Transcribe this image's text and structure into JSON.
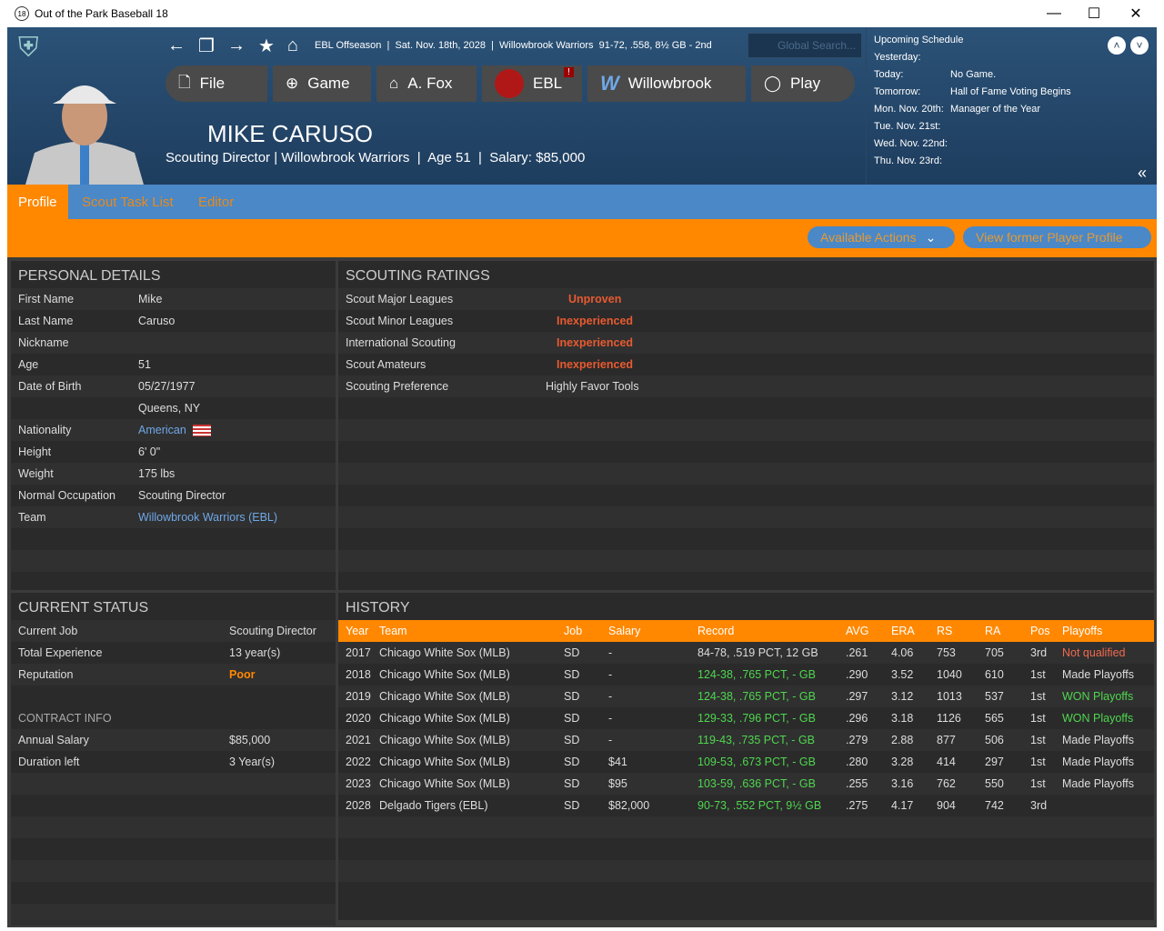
{
  "window": {
    "title": "Out of the Park Baseball 18",
    "icon_text": "18"
  },
  "nav": {
    "info": "EBL Offseason  |  Sat. Nov. 18th, 2028  |  Willowbrook Warriors  91-72, .558, 8½ GB - 2nd",
    "search_placeholder": "Global Search..."
  },
  "menu": [
    "File",
    "Game",
    "A. Fox",
    "EBL",
    "Willowbrook",
    "Play"
  ],
  "menu_badge": "!",
  "person": {
    "name": "MIKE CARUSO",
    "subtitle": "Scouting Director | Willowbrook Warriors  |  Age 51  |  Salary: $85,000"
  },
  "schedule": {
    "title": "Upcoming Schedule",
    "items": [
      {
        "day": "Yesterday:",
        "event": ""
      },
      {
        "day": "Today:",
        "event": "No Game."
      },
      {
        "day": "Tomorrow:",
        "event": "Hall of Fame Voting Begins"
      },
      {
        "day": "Mon. Nov. 20th:",
        "event": "Manager of the Year"
      },
      {
        "day": "Tue. Nov. 21st:",
        "event": ""
      },
      {
        "day": "Wed. Nov. 22nd:",
        "event": ""
      },
      {
        "day": "Thu. Nov. 23rd:",
        "event": ""
      }
    ]
  },
  "tabs": [
    "Profile",
    "Scout Task List",
    "Editor"
  ],
  "actions": {
    "available": "Available Actions",
    "former": "View former Player Profile"
  },
  "personal": {
    "title": "PERSONAL DETAILS",
    "rows": [
      [
        "First Name",
        "Mike"
      ],
      [
        "Last Name",
        "Caruso"
      ],
      [
        "Nickname",
        ""
      ],
      [
        "Age",
        "51"
      ],
      [
        "Date of Birth",
        "05/27/1977"
      ],
      [
        "",
        "Queens, NY"
      ],
      [
        "Nationality",
        "American"
      ],
      [
        "Height",
        "6' 0\""
      ],
      [
        "Weight",
        "175 lbs"
      ],
      [
        "Normal Occupation",
        "Scouting Director"
      ],
      [
        "Team",
        "Willowbrook Warriors (EBL)"
      ]
    ]
  },
  "scouting": {
    "title": "SCOUTING RATINGS",
    "rows": [
      [
        "Scout Major Leagues",
        "Unproven"
      ],
      [
        "Scout Minor Leagues",
        "Inexperienced"
      ],
      [
        "International Scouting",
        "Inexperienced"
      ],
      [
        "Scout Amateurs",
        "Inexperienced"
      ],
      [
        "Scouting Preference",
        "Highly Favor Tools"
      ]
    ]
  },
  "status": {
    "title": "CURRENT STATUS",
    "rows": [
      [
        "Current Job",
        "Scouting Director"
      ],
      [
        "Total Experience",
        "13 year(s)"
      ],
      [
        "Reputation",
        "Poor"
      ]
    ],
    "contract_title": "CONTRACT INFO",
    "contract": [
      [
        "Annual Salary",
        "$85,000"
      ],
      [
        "Duration left",
        "3 Year(s)"
      ]
    ]
  },
  "history": {
    "title": "HISTORY",
    "columns": [
      "Year",
      "Team",
      "Job",
      "Salary",
      "Record",
      "AVG",
      "ERA",
      "RS",
      "RA",
      "Pos",
      "Playoffs"
    ],
    "rows": [
      [
        "2017",
        "Chicago White Sox (MLB)",
        "SD",
        "-",
        "84-78, .519 PCT, 12 GB",
        ".261",
        "4.06",
        "753",
        "705",
        "3rd",
        "Not qualified"
      ],
      [
        "2018",
        "Chicago White Sox (MLB)",
        "SD",
        "-",
        "124-38, .765 PCT, - GB",
        ".290",
        "3.52",
        "1040",
        "610",
        "1st",
        "Made Playoffs"
      ],
      [
        "2019",
        "Chicago White Sox (MLB)",
        "SD",
        "-",
        "124-38, .765 PCT, - GB",
        ".297",
        "3.12",
        "1013",
        "537",
        "1st",
        "WON Playoffs"
      ],
      [
        "2020",
        "Chicago White Sox (MLB)",
        "SD",
        "-",
        "129-33, .796 PCT, - GB",
        ".296",
        "3.18",
        "1126",
        "565",
        "1st",
        "WON Playoffs"
      ],
      [
        "2021",
        "Chicago White Sox (MLB)",
        "SD",
        "-",
        "119-43, .735 PCT, - GB",
        ".279",
        "2.88",
        "877",
        "506",
        "1st",
        "Made Playoffs"
      ],
      [
        "2022",
        "Chicago White Sox (MLB)",
        "SD",
        "$41",
        "109-53, .673 PCT, - GB",
        ".280",
        "3.28",
        "414",
        "297",
        "1st",
        "Made Playoffs"
      ],
      [
        "2023",
        "Chicago White Sox (MLB)",
        "SD",
        "$95",
        "103-59, .636 PCT, - GB",
        ".255",
        "3.16",
        "762",
        "550",
        "1st",
        "Made Playoffs"
      ],
      [
        "2028",
        "Delgado Tigers (EBL)",
        "SD",
        "$82,000",
        "90-73, .552 PCT, 9½ GB",
        ".275",
        "4.17",
        "904",
        "742",
        "3rd",
        ""
      ]
    ]
  }
}
